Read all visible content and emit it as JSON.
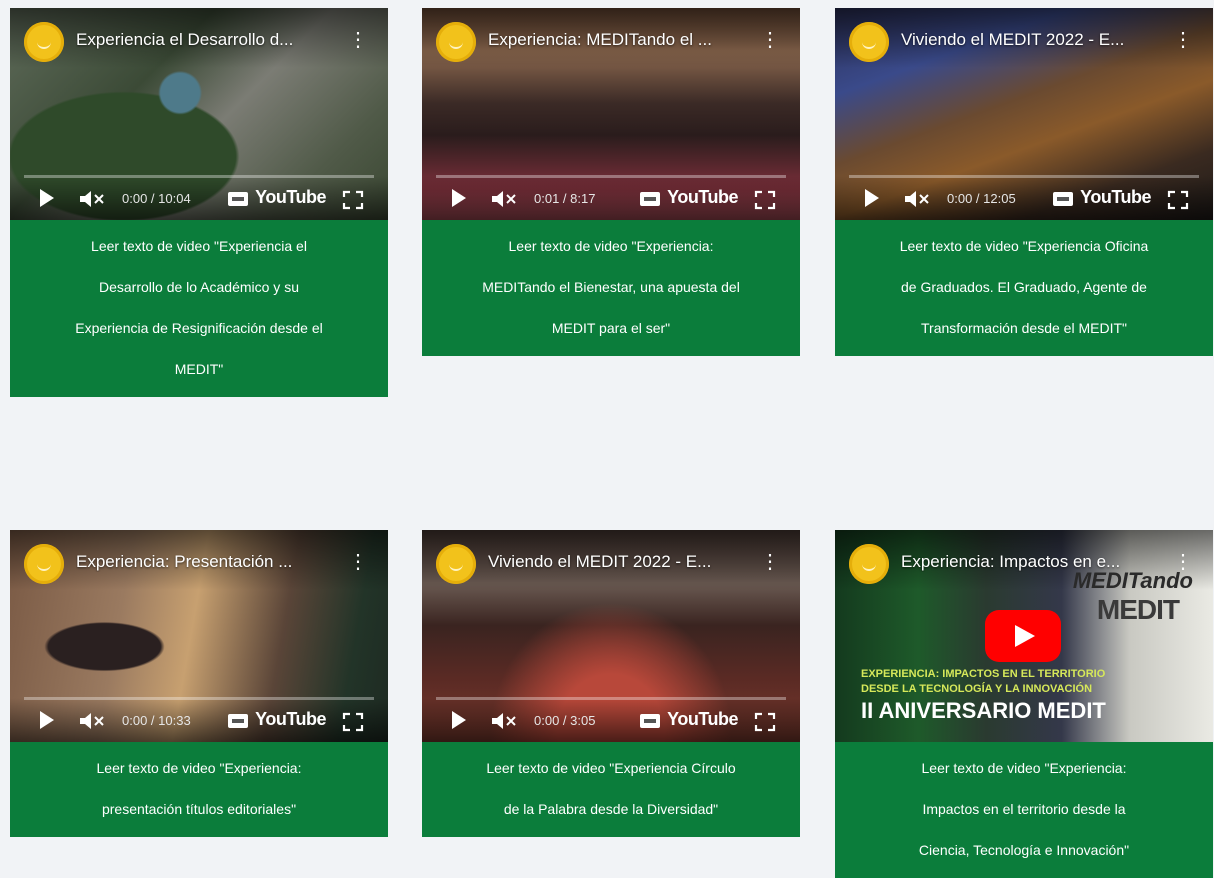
{
  "videos": [
    {
      "title": "Experiencia el Desarrollo d...",
      "time": "0:00 / 10:04",
      "caption": [
        "Leer texto de video \"Experiencia el",
        "Desarrollo de lo Académico y su",
        "Experiencia de Resignificación desde el",
        "MEDIT\""
      ]
    },
    {
      "title": "Experiencia: MEDITando el ...",
      "time": "0:01 / 8:17",
      "caption": [
        "Leer texto de video \"Experiencia:",
        "MEDITando el Bienestar, una apuesta del",
        "MEDIT para el ser\""
      ]
    },
    {
      "title": "Viviendo el MEDIT 2022 - E...",
      "time": "0:00 / 12:05",
      "caption": [
        "Leer texto de video \"Experiencia Oficina",
        "de Graduados. El Graduado, Agente de",
        "Transformación desde el MEDIT\""
      ]
    },
    {
      "title": "Experiencia: Presentación ...",
      "time": "0:00 / 10:33",
      "caption": [
        "Leer texto de video \"Experiencia:",
        "presentación títulos editoriales\""
      ]
    },
    {
      "title": "Viviendo el MEDIT 2022 - E...",
      "time": "0:00 / 3:05",
      "caption": [
        "Leer texto de video \"Experiencia Círculo",
        "de la Palabra desde la Diversidad\""
      ]
    },
    {
      "title": "Experiencia: Impactos en e...",
      "time": "",
      "overlay": {
        "brand": "MEDITando",
        "brand_sub": "MEDIT",
        "headline1": "EXPERIENCIA: IMPACTOS EN EL TERRITORIO",
        "headline2": "DESDE LA TECNOLOGÍA Y LA INNOVACIÓN",
        "banner": "II ANIVERSARIO MEDIT"
      },
      "caption": [
        "Leer texto de video \"Experiencia:",
        "Impactos en el territorio desde la",
        "Ciencia, Tecnología e Innovación\""
      ]
    }
  ],
  "player": {
    "brand_label": "YouTube"
  },
  "colors": {
    "caption_bg": "#0b7d3b",
    "page_bg": "#f1f3f6",
    "logo": "#f2c21b"
  }
}
